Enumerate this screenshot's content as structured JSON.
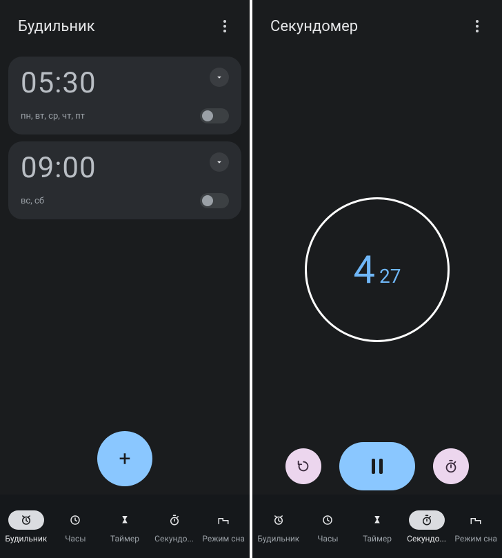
{
  "left": {
    "title": "Будильник",
    "alarms": [
      {
        "time": "05:30",
        "days": "пн, вт, ср, чт, пт",
        "enabled": false
      },
      {
        "time": "09:00",
        "days": "вс, сб",
        "enabled": false
      }
    ],
    "fab": "+",
    "nav": {
      "items": [
        {
          "label": "Будильник"
        },
        {
          "label": "Часы"
        },
        {
          "label": "Таймер"
        },
        {
          "label": "Секундо..."
        },
        {
          "label": "Режим сна"
        }
      ],
      "active": 0
    }
  },
  "right": {
    "title": "Секундомер",
    "stopwatch": {
      "seconds": "4",
      "centiseconds": "27"
    },
    "nav": {
      "items": [
        {
          "label": "Будильник"
        },
        {
          "label": "Часы"
        },
        {
          "label": "Таймер"
        },
        {
          "label": "Секундо..."
        },
        {
          "label": "Режим сна"
        }
      ],
      "active": 3
    }
  }
}
